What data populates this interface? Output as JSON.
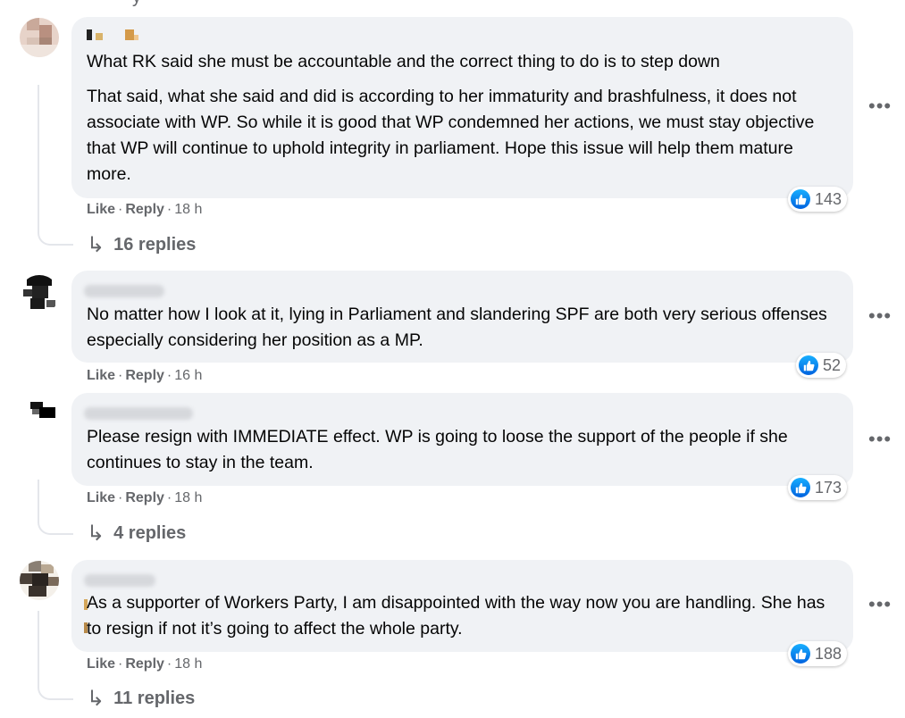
{
  "top_partial": "y",
  "comments": [
    {
      "paragraphs": [
        "What RK said she must be accountable and the correct thing to do is to step down",
        "That said, what she said and did is according to her immaturity and brashfulness, it does not associate with WP. So while it is good that WP condemned her actions, we must stay objective that WP will continue to uphold integrity in parliament. Hope this issue will help them mature more."
      ],
      "like": "Like",
      "reply": "Reply",
      "time": "18 h",
      "reactions": "143",
      "replies": "16 replies"
    },
    {
      "paragraphs": [
        "No matter how I look at it, lying in Parliament and slandering SPF are both very serious offenses especially considering her position as a MP."
      ],
      "like": "Like",
      "reply": "Reply",
      "time": "16 h",
      "reactions": "52"
    },
    {
      "paragraphs": [
        "Please resign with IMMEDIATE effect. WP is going to loose the support of the people if she continues to stay in the team."
      ],
      "like": "Like",
      "reply": "Reply",
      "time": "18 h",
      "reactions": "173",
      "replies": "4 replies"
    },
    {
      "paragraphs": [
        "As a supporter of Workers Party, I am disappointed with the way now you are handling. She has to resign if not it’s going to affect the whole party."
      ],
      "like": "Like",
      "reply": "Reply",
      "time": "18 h",
      "reactions": "188",
      "replies": "11 replies"
    }
  ],
  "icons": {
    "like": "like-thumb-icon",
    "more": "more-options-icon",
    "reply_arrow": "reply-arrow-icon"
  },
  "colors": {
    "bubble": "#f0f2f5",
    "meta_text": "#65676b",
    "like_blue": "#0a7cff"
  }
}
